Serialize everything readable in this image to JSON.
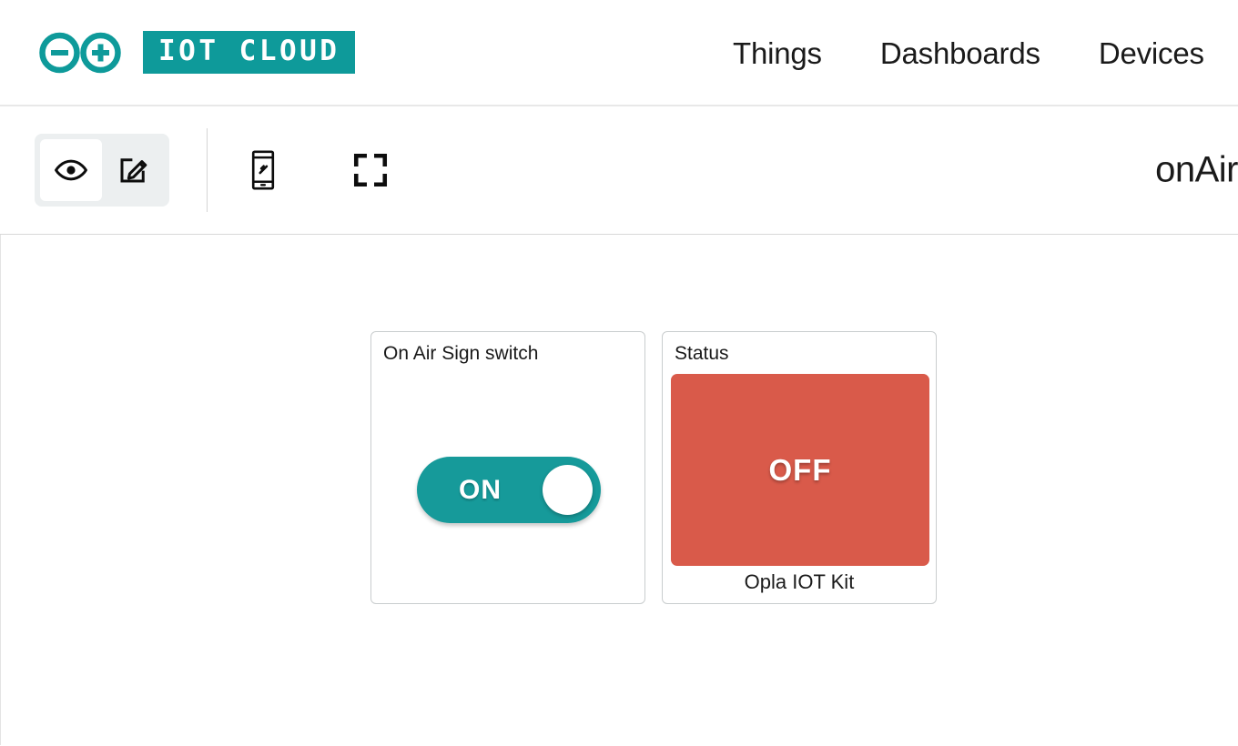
{
  "header": {
    "logo_icon": "arduino-infinity-logo",
    "badge_text": "IOT CLOUD",
    "brand_color": "#0e9a9a",
    "nav": [
      {
        "label": "Things"
      },
      {
        "label": "Dashboards"
      },
      {
        "label": "Devices"
      }
    ]
  },
  "toolbar": {
    "mode_buttons": [
      {
        "icon": "eye-icon",
        "name": "view-mode",
        "active": true
      },
      {
        "icon": "edit-square-pencil-icon",
        "name": "edit-mode",
        "active": false
      }
    ],
    "tools": [
      {
        "icon": "mobile-layout-icon",
        "name": "mobile-layout"
      },
      {
        "icon": "fullscreen-icon",
        "name": "fullscreen"
      }
    ],
    "dashboard_title": "onAir"
  },
  "widgets": [
    {
      "title": "On Air Sign switch",
      "type": "switch",
      "state_label": "ON",
      "state": "on",
      "accent_color": "#169a9a"
    },
    {
      "title": "Status",
      "type": "status",
      "value": "OFF",
      "caption": "Opla IOT Kit",
      "status_color": "#d95a4a"
    }
  ]
}
